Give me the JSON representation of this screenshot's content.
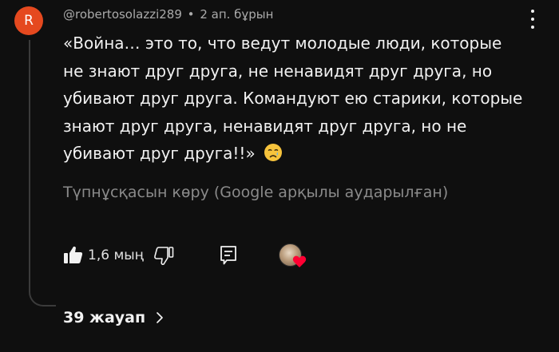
{
  "comment": {
    "avatar_letter": "R",
    "avatar_color": "#e5491f",
    "author": "@robertosolazzi289",
    "separator": "•",
    "time": "2 ап. бұрын",
    "lines": [
      "«Война… это то, что ведут молодые люди, которые",
      "не знают друг друга, не ненавидят друг друга, но",
      "убивают друг друга. Командуют ею старики, которые",
      "знают друг друга, ненавидят друг друга, но не",
      "убивают друг друга!!»"
    ],
    "emoji": "crying-face",
    "translate_link": "Түпнұсқасын көру (Google арқылы аударылған)"
  },
  "actions": {
    "like_icon": "thumbs-up-filled-icon",
    "like_count": "1,6 мың",
    "dislike_icon": "thumbs-down-outline-icon",
    "reply_icon": "reply-icon",
    "creator_heart_icon": "heart-icon",
    "heart_color": "#ff0033"
  },
  "replies": {
    "label": "39 жауап",
    "icon": "chevron-right-icon"
  }
}
